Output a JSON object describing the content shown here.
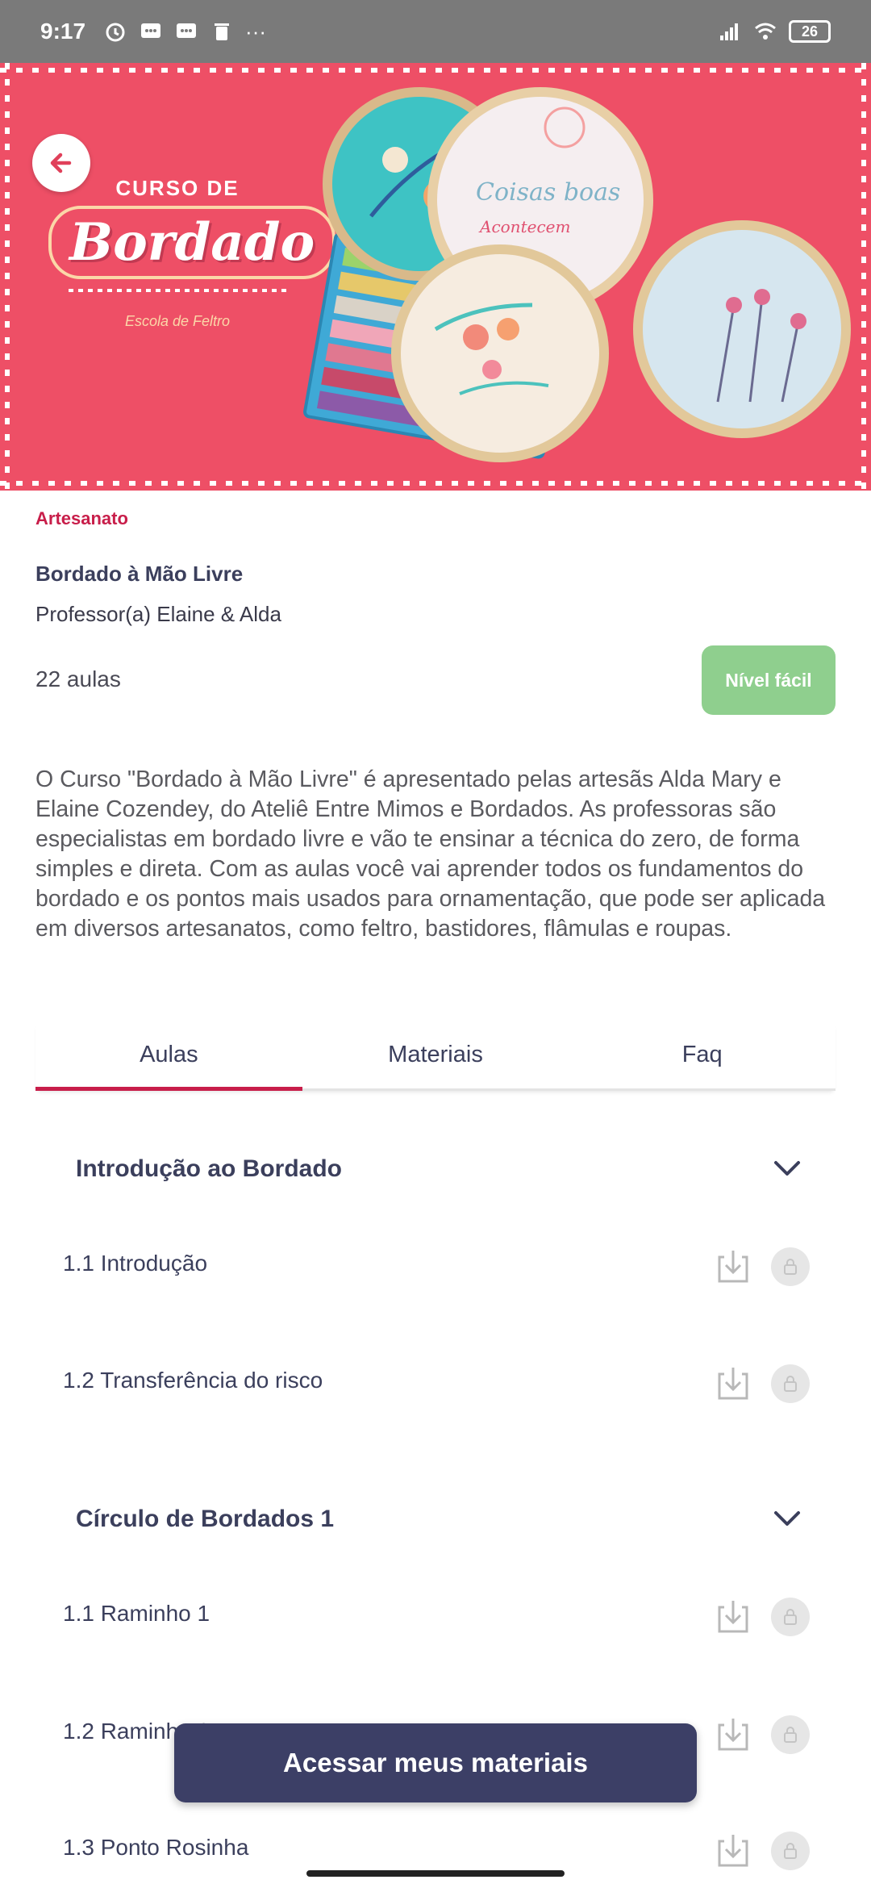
{
  "status_bar": {
    "time": "9:17",
    "battery": "26"
  },
  "hero": {
    "logo_line1": "CURSO DE",
    "logo_line2": "Bordado",
    "logo_line3": "Escola de Feltro",
    "background_color": "#ee4f66"
  },
  "course": {
    "category": "Artesanato",
    "title": "Bordado à Mão Livre",
    "professor": "Professor(a) Elaine & Alda",
    "lessons_count": "22 aulas",
    "level": "Nível fácil",
    "description": "O Curso \"Bordado à Mão Livre\" é apresentado pelas artesãs Alda Mary e Elaine Cozendey, do Ateliê Entre Mimos e Bordados. As professoras são especialistas em bordado livre e vão te ensinar a técnica do zero, de forma simples e direta. Com as aulas você vai aprender todos os fundamentos do bordado e os pontos mais usados para ornamentação, que pode ser aplicada em diversos artesanatos, como feltro, bastidores, flâmulas e roupas."
  },
  "tabs": [
    {
      "label": "Aulas",
      "active": true
    },
    {
      "label": "Materiais",
      "active": false
    },
    {
      "label": "Faq",
      "active": false
    }
  ],
  "sections": [
    {
      "title": "Introdução ao Bordado",
      "lessons": [
        "1.1 Introdução",
        "1.2 Transferência do risco"
      ]
    },
    {
      "title": "Círculo de Bordados 1",
      "lessons": [
        "1.1 Raminho 1",
        "1.2 Raminho 2",
        "1.3 Ponto Rosinha"
      ]
    }
  ],
  "cta": {
    "label": "Acessar meus materiais"
  },
  "colors": {
    "accent": "#c81e4a",
    "level_badge": "#8fcf8e",
    "cta": "#3c3f66"
  }
}
